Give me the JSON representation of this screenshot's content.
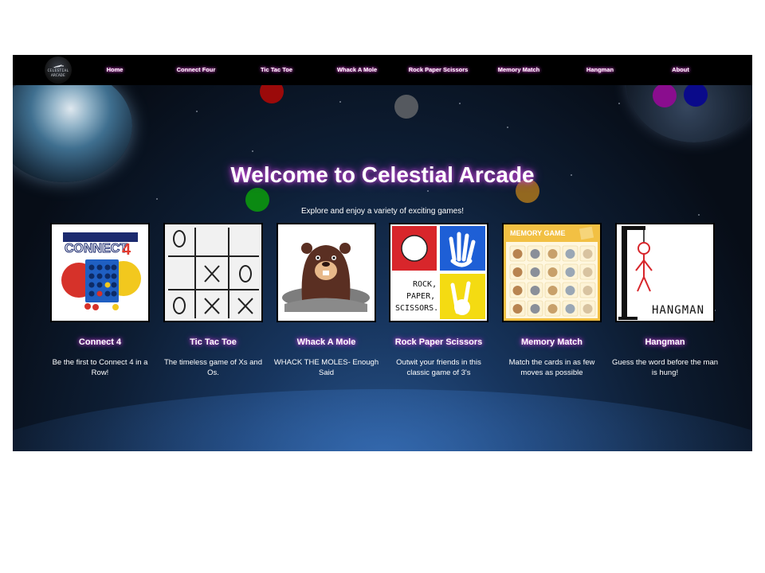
{
  "logo": {
    "line1": "CELESTIAL",
    "line2": "ARCADE"
  },
  "nav": [
    {
      "label": "Home"
    },
    {
      "label": "Connect Four"
    },
    {
      "label": "Tic Tac Toe"
    },
    {
      "label": "Whack A Mole"
    },
    {
      "label": "Rock Paper Scissors"
    },
    {
      "label": "Memory Match"
    },
    {
      "label": "Hangman"
    },
    {
      "label": "About"
    }
  ],
  "hero": {
    "title": "Welcome to Celestial Arcade",
    "subtitle": "Explore and enjoy a variety of exciting games!"
  },
  "games": [
    {
      "title": "Connect 4",
      "description": "Be the first to Connect 4 in a Row!",
      "art_text": "CONNECT",
      "art_number": "4"
    },
    {
      "title": "Tic Tac Toe",
      "description": "The timeless game of Xs and Os."
    },
    {
      "title": "Whack A Mole",
      "description": "WHACK THE MOLES- Enough Said"
    },
    {
      "title": "Rock Paper Scissors",
      "description": "Outwit your friends in this classic game of 3's",
      "art_lines": [
        "ROCK,",
        "PAPER,",
        "SCISSORS."
      ]
    },
    {
      "title": "Memory Match",
      "description": "Match the cards in as few moves as possible",
      "art_text": "MEMORY GAME"
    },
    {
      "title": "Hangman",
      "description": "Guess the word before the man is hung!",
      "art_text": "HANGMAN"
    }
  ],
  "colors": {
    "nav_bg": "#000000",
    "title_glow": "#c84ad8",
    "ball_red": "#9b0a0a",
    "ball_gray": "#55595f",
    "ball_green": "#0b8a12",
    "ball_orange": "#c0811a",
    "ball_purple": "#8a0d8e",
    "ball_blue": "#0a0a8a"
  }
}
